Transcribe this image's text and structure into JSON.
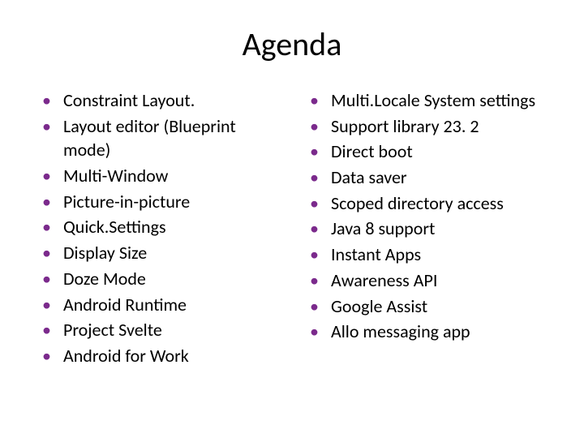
{
  "title": "Agenda",
  "left": [
    "Constraint Layout.",
    "Layout editor (Blueprint mode)",
    "Multi-Window",
    "Picture-in-picture",
    "Quick.Settings",
    "Display Size",
    "Doze Mode",
    "Android Runtime",
    "Project Svelte",
    "Android for Work"
  ],
  "right": [
    "Multi.Locale System settings",
    "Support library 23. 2",
    "Direct boot",
    "Data saver",
    "Scoped directory access",
    "Java 8 support",
    "Instant Apps",
    "Awareness API",
    "Google Assist",
    "Allo messaging app"
  ]
}
